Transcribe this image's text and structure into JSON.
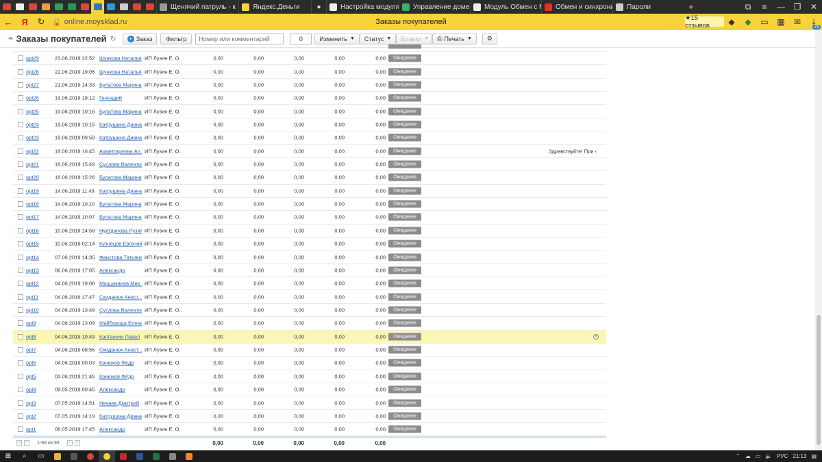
{
  "browser": {
    "tabs": [
      {
        "label": "Щенячий патруль - к",
        "color": "#9a9a9a"
      },
      {
        "label": "Яндекс.Деньги",
        "color": "#f6d33a"
      },
      {
        "label": "Настройка модуля \"I",
        "color": "#eeeeee"
      },
      {
        "label": "Управление доменам",
        "color": "#3cae6a"
      },
      {
        "label": "Модуль Обмен с Мо",
        "color": "#eeeeee"
      },
      {
        "label": "Обмен и синхрониза",
        "color": "#dd3322"
      },
      {
        "label": "Пароли",
        "color": "#cccccc"
      }
    ],
    "new_tab": "+",
    "url": "online.moysklad.ru",
    "page_title": "Заказы покупателей",
    "reviews_badge": "★15 отзывов",
    "downloads_badge": "25"
  },
  "toolbar": {
    "title": "Заказы покупателей",
    "add_order": "Заказ",
    "filter": "Фильтр",
    "search_placeholder": "Номер или комментарий",
    "counter": "0",
    "change": "Изменить",
    "status": "Статус",
    "disabled_btn": "Бланки",
    "print": "Печать"
  },
  "rows": [
    {
      "num": "opt29",
      "date": "23.06.2019 22:52",
      "customer": "Шункова Наталья",
      "org": "ИП Лузин Е. О.",
      "a": "0,00",
      "b": "0,00",
      "c": "0,00",
      "d": "0,00",
      "e": "0,00",
      "status": "Ожидание",
      "comment": ""
    },
    {
      "num": "opt28",
      "date": "22.06.2019 19:05",
      "customer": "Шункова Наталья",
      "org": "ИП Лузин Е. О.",
      "a": "0,00",
      "b": "0,00",
      "c": "0,00",
      "d": "0,00",
      "e": "0,00",
      "status": "Ожидание",
      "comment": ""
    },
    {
      "num": "opt27",
      "date": "21.06.2019 14:33",
      "customer": "Булатова Марина",
      "org": "ИП Лузин Е. О.",
      "a": "0,00",
      "b": "0,00",
      "c": "0,00",
      "d": "0,00",
      "e": "0,00",
      "status": "Ожидание",
      "comment": ""
    },
    {
      "num": "opt26",
      "date": "19.06.2019 18:12",
      "customer": "Геннадий",
      "org": "ИП Лузин Е. О.",
      "a": "0,00",
      "b": "0,00",
      "c": "0,00",
      "d": "0,00",
      "e": "0,00",
      "status": "Ожидание",
      "comment": ""
    },
    {
      "num": "opt25",
      "date": "19.06.2019 10:16",
      "customer": "Булатова Марина",
      "org": "ИП Лузин Е. О.",
      "a": "0,00",
      "b": "0,00",
      "c": "0,00",
      "d": "0,00",
      "e": "0,00",
      "status": "Ожидание",
      "comment": ""
    },
    {
      "num": "opt24",
      "date": "19.06.2019 10:15",
      "customer": "Катрушина Диана",
      "org": "ИП Лузин Е. О.",
      "a": "0,00",
      "b": "0,00",
      "c": "0,00",
      "d": "0,00",
      "e": "0,00",
      "status": "Ожидание",
      "comment": ""
    },
    {
      "num": "opt23",
      "date": "19.06.2019 09:59",
      "customer": "Катрушина Диана",
      "org": "ИП Лузин Е. О.",
      "a": "0,00",
      "b": "0,00",
      "c": "0,00",
      "d": "0,00",
      "e": "0,00",
      "status": "Ожидание",
      "comment": ""
    },
    {
      "num": "opt22",
      "date": "18.06.2019 16:45",
      "customer": "Ахметгареева Ал...",
      "org": "ИП Лузин Е. О.",
      "a": "0,00",
      "b": "0,00",
      "c": "0,00",
      "d": "0,00",
      "e": "0,00",
      "status": "Ожидание",
      "comment": "Здравствуйте! При ‹"
    },
    {
      "num": "opt21",
      "date": "18.06.2019 15:49",
      "customer": "Суслова Валентина",
      "org": "ИП Лузин Е. О.",
      "a": "0,00",
      "b": "0,00",
      "c": "0,00",
      "d": "0,00",
      "e": "0,00",
      "status": "Ожидание",
      "comment": ""
    },
    {
      "num": "opt20",
      "date": "18.06.2019 15:26",
      "customer": "Булатова Марина",
      "org": "ИП Лузин Е. О.",
      "a": "0,00",
      "b": "0,00",
      "c": "0,00",
      "d": "0,00",
      "e": "0,00",
      "status": "Ожидание",
      "comment": ""
    },
    {
      "num": "opt19",
      "date": "14.06.2019 11:49",
      "customer": "Катрушина Диана",
      "org": "ИП Лузин Е. О.",
      "a": "0,00",
      "b": "0,00",
      "c": "0,00",
      "d": "0,00",
      "e": "0,00",
      "status": "Ожидание",
      "comment": ""
    },
    {
      "num": "opt18",
      "date": "14.06.2019 10:10",
      "customer": "Булатова Марина",
      "org": "ИП Лузин Е. О.",
      "a": "0,00",
      "b": "0,00",
      "c": "0,00",
      "d": "0,00",
      "e": "0,00",
      "status": "Ожидание",
      "comment": ""
    },
    {
      "num": "opt17",
      "date": "14.06.2019 10:07",
      "customer": "Булатова Марина",
      "org": "ИП Лузин Е. О.",
      "a": "0,00",
      "b": "0,00",
      "c": "0,00",
      "d": "0,00",
      "e": "0,00",
      "status": "Ожидание",
      "comment": ""
    },
    {
      "num": "opt16",
      "date": "10.06.2019 14:59",
      "customer": "Нуртдинова Рузия",
      "org": "ИП Лузин Е. О.",
      "a": "0,00",
      "b": "0,00",
      "c": "0,00",
      "d": "0,00",
      "e": "0,00",
      "status": "Ожидание",
      "comment": ""
    },
    {
      "num": "opt15",
      "date": "10.06.2019 02:14",
      "customer": "Кузнецов Евгений",
      "org": "ИП Лузин Е. О.",
      "a": "0,00",
      "b": "0,00",
      "c": "0,00",
      "d": "0,00",
      "e": "0,00",
      "status": "Ожидание",
      "comment": ""
    },
    {
      "num": "opt14",
      "date": "07.06.2019 14:35",
      "customer": "Фаистова Татьяна",
      "org": "ИП Лузин Е. О.",
      "a": "0,00",
      "b": "0,00",
      "c": "0,00",
      "d": "0,00",
      "e": "0,00",
      "status": "Ожидание",
      "comment": ""
    },
    {
      "num": "opt13",
      "date": "06.06.2019 17:05",
      "customer": "Александр",
      "org": "ИП Лузин Е. О.",
      "a": "0,00",
      "b": "0,00",
      "c": "0,00",
      "d": "0,00",
      "e": "0,00",
      "status": "Ожидание",
      "comment": ""
    },
    {
      "num": "opt12",
      "date": "04.06.2019 18:08",
      "customer": "Миццаканов Мих...",
      "org": "ИП Лузин Е. О.",
      "a": "0,00",
      "b": "0,00",
      "c": "0,00",
      "d": "0,00",
      "e": "0,00",
      "status": "Ожидание",
      "comment": ""
    },
    {
      "num": "opt11",
      "date": "04.06.2019 17:47",
      "customer": "Скиданюк Анаст...",
      "org": "ИП Лузин Е. О.",
      "a": "0,00",
      "b": "0,00",
      "c": "0,00",
      "d": "0,00",
      "e": "0,00",
      "status": "Ожидание",
      "comment": ""
    },
    {
      "num": "opt10",
      "date": "04.06.2019 13:49",
      "customer": "Суслова Валентина",
      "org": "ИП Лузин Е. О.",
      "a": "0,00",
      "b": "0,00",
      "c": "0,00",
      "d": "0,00",
      "e": "0,00",
      "status": "Ожидание",
      "comment": ""
    },
    {
      "num": "opt9",
      "date": "04.06.2019 13:09",
      "customer": "Майборода Елена",
      "org": "ИП Лузин Е. О.",
      "a": "0,00",
      "b": "0,00",
      "c": "0,00",
      "d": "0,00",
      "e": "0,00",
      "status": "Ожидание",
      "comment": ""
    },
    {
      "num": "opt8",
      "date": "04.06.2019 10:43",
      "customer": "Калганкин Павел",
      "org": "ИП Лузин Е. О.",
      "a": "0,00",
      "b": "0,00",
      "c": "0,00",
      "d": "0,00",
      "e": "0,00",
      "status": "Ожидание",
      "comment": "",
      "highlighted": true
    },
    {
      "num": "opt7",
      "date": "04.06.2019 08:55",
      "customer": "Скиданюк Анаст...",
      "org": "ИП Лузин Е. О.",
      "a": "0,00",
      "b": "0,00",
      "c": "0,00",
      "d": "0,00",
      "e": "0,00",
      "status": "Ожидание",
      "comment": ""
    },
    {
      "num": "opt6",
      "date": "04.06.2019 00:03",
      "customer": "Конюхов Фёдр",
      "org": "ИП Лузин Е. О.",
      "a": "0,00",
      "b": "0,00",
      "c": "0,00",
      "d": "0,00",
      "e": "0,00",
      "status": "Ожидание",
      "comment": ""
    },
    {
      "num": "opt5",
      "date": "03.06.2019 21:46",
      "customer": "Конюхов Фёдр",
      "org": "ИП Лузин Е. О.",
      "a": "0,00",
      "b": "0,00",
      "c": "0,00",
      "d": "0,00",
      "e": "0,00",
      "status": "Ожидание",
      "comment": ""
    },
    {
      "num": "opt4",
      "date": "09.05.2019 00:45",
      "customer": "Александр",
      "org": "ИП Лузин Е. О.",
      "a": "0,00",
      "b": "0,00",
      "c": "0,00",
      "d": "0,00",
      "e": "0,00",
      "status": "Ожидание",
      "comment": ""
    },
    {
      "num": "opt3",
      "date": "07.05.2019 14:51",
      "customer": "Нечаев Дмитрий",
      "org": "ИП Лузин Е. О.",
      "a": "0,00",
      "b": "0,00",
      "c": "0,00",
      "d": "0,00",
      "e": "0,00",
      "status": "Ожидание",
      "comment": ""
    },
    {
      "num": "opt2",
      "date": "07.05.2019 14:19",
      "customer": "Катрушина Диана",
      "org": "ИП Лузин Е. О.",
      "a": "0,00",
      "b": "0,00",
      "c": "0,00",
      "d": "0,00",
      "e": "0,00",
      "status": "Ожидание",
      "comment": ""
    },
    {
      "num": "opt1",
      "date": "06.05.2019 17:45",
      "customer": "Александр",
      "org": "ИП Лузин Е. О.",
      "a": "0,00",
      "b": "0,00",
      "c": "0,00",
      "d": "0,00",
      "e": "0,00",
      "status": "Ожидание",
      "comment": ""
    }
  ],
  "totals": {
    "pager_text": "1-93 из 93",
    "a": "0,00",
    "b": "0,00",
    "c": "0,00",
    "d": "0,00",
    "e": "0,00"
  },
  "taskbar": {
    "lang": "РУС",
    "time": "21:13"
  },
  "colors": {
    "accent": "#f6d33a",
    "link": "#2462b5",
    "status_badge": "#8c8c8c",
    "highlight_row": "#fbf6b4"
  }
}
